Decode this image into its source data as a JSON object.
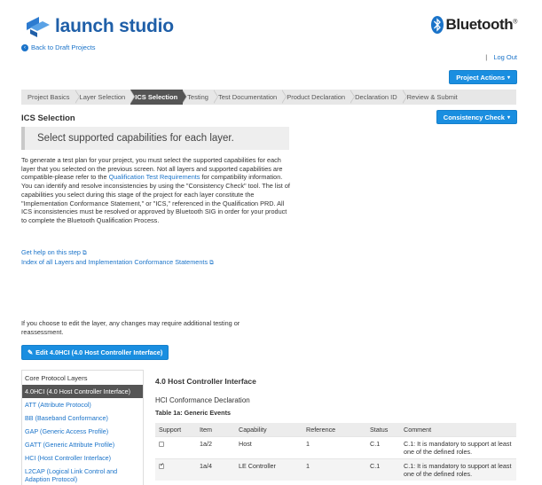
{
  "brand": {
    "logo_text": "launch studio",
    "bluetooth_text": "Bluetooth",
    "bluetooth_tm": "®"
  },
  "nav": {
    "back_label": "Back to Draft Projects",
    "logout_sep": "|",
    "logout_label": "Log Out"
  },
  "actions": {
    "project_actions": "Project Actions",
    "consistency_check": "Consistency Check"
  },
  "steps": [
    {
      "label": "Project Basics"
    },
    {
      "label": "Layer Selection"
    },
    {
      "label": "ICS Selection"
    },
    {
      "label": "Testing"
    },
    {
      "label": "Test Documentation"
    },
    {
      "label": "Product Declaration"
    },
    {
      "label": "Declaration ID"
    },
    {
      "label": "Review & Submit"
    }
  ],
  "page": {
    "heading": "ICS Selection",
    "callout": "Select supported capabilities for each layer.",
    "intro_before_link": "To generate a test plan for your project, you must select the supported capabilities for each layer that you selected on the previous screen. Not all layers and supported capabilities are compatible-please refer to the ",
    "intro_link": "Qualification Test Requirements",
    "intro_after_link": " for compatibility information. You can identify and resolve inconsistencies by using the \"Consistency Check\" tool. The list of capabilities you select during this stage of the project for each layer constitute the \"Implementation Conformance Statement,\" or \"ICS,\" referenced in the Qualification PRD. All ICS inconsistencies must be resolved or approved by Bluetooth SIG in order for your product to complete the Bluetooth Qualification Process.",
    "help_link": "Get help on this step",
    "index_link": "Index of all Layers and Implementation Conformance Statements",
    "edit_note": "If you choose to edit the layer, any changes may require additional testing or reassessment.",
    "edit_button": "Edit 4.0HCI (4.0 Host Controller Interface)"
  },
  "sidebar": {
    "heading": "Core Protocol Layers",
    "items": [
      {
        "label": "4.0HCI (4.0 Host Controller Interface)",
        "active": true
      },
      {
        "label": "ATT (Attribute Protocol)"
      },
      {
        "label": "BB (Baseband Conformance)"
      },
      {
        "label": "GAP (Generic Access Profile)"
      },
      {
        "label": "GATT (Generic Attribute Profile)"
      },
      {
        "label": "HCI (Host Controller Interface)"
      },
      {
        "label": "L2CAP (Logical Link Control and Adaption Protocol)"
      }
    ]
  },
  "content": {
    "title": "4.0 Host Controller Interface",
    "subtitle": "HCI Conformance Declaration",
    "table_caption": "Table 1a: Generic Events",
    "columns": [
      "Support",
      "Item",
      "Capability",
      "Reference",
      "Status",
      "Comment"
    ],
    "rows": [
      {
        "checked": false,
        "item": "1a/2",
        "capability": "Host",
        "reference": "1",
        "status": "C.1",
        "comment": "C.1: It is mandatory to support at least one of the defined roles."
      },
      {
        "checked": true,
        "item": "1a/4",
        "capability": "LE Controller",
        "reference": "1",
        "status": "C.1",
        "comment": "C.1: It is mandatory to support at least one of the defined roles."
      }
    ]
  },
  "colors": {
    "accent": "#1a8ee0",
    "brand": "#1f5fa8",
    "step_active": "#555555"
  }
}
